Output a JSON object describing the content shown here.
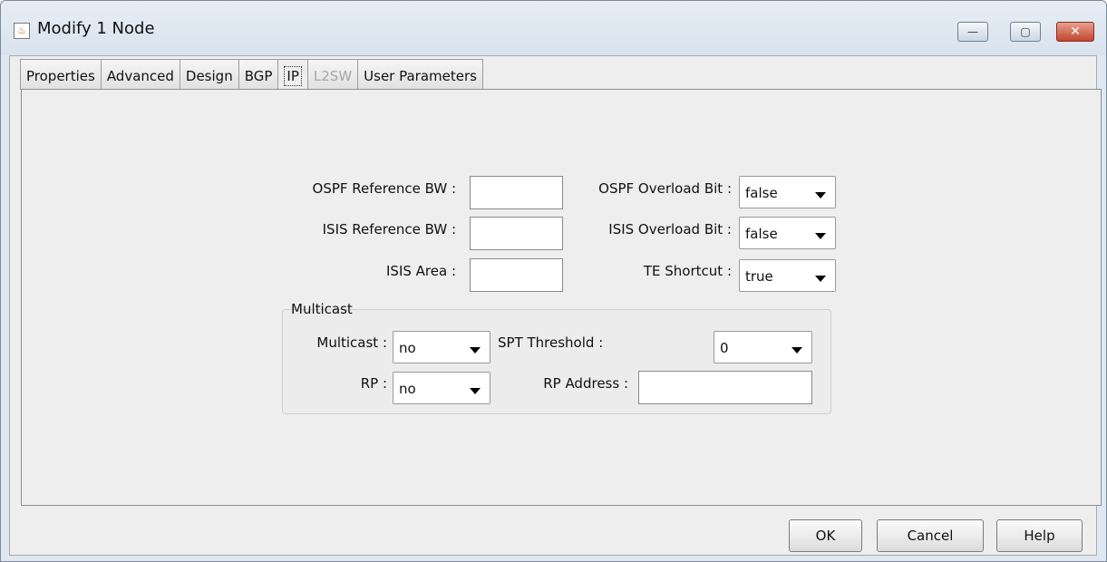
{
  "window": {
    "title": "Modify 1 Node",
    "controls": {
      "minimize": "—",
      "maximize": "▢",
      "close": "✕"
    }
  },
  "tabs": [
    {
      "label": "Properties",
      "state": "normal"
    },
    {
      "label": "Advanced",
      "state": "normal"
    },
    {
      "label": "Design",
      "state": "normal"
    },
    {
      "label": "BGP",
      "state": "normal"
    },
    {
      "label": "IP",
      "state": "active"
    },
    {
      "label": "L2SW",
      "state": "disabled"
    },
    {
      "label": "User Parameters",
      "state": "normal"
    }
  ],
  "ip": {
    "ospf_ref_bw_label": "OSPF Reference BW :",
    "ospf_ref_bw_value": "",
    "isis_ref_bw_label": "ISIS Reference BW :",
    "isis_ref_bw_value": "",
    "isis_area_label": "ISIS Area :",
    "isis_area_value": "",
    "ospf_overload_label": "OSPF Overload Bit :",
    "ospf_overload_value": "false",
    "isis_overload_label": "ISIS Overload Bit :",
    "isis_overload_value": "false",
    "te_shortcut_label": "TE Shortcut :",
    "te_shortcut_value": "true"
  },
  "multicast": {
    "group_title": "Multicast",
    "multicast_label": "Multicast :",
    "multicast_value": "no",
    "spt_label": "SPT Threshold :",
    "spt_value": "0",
    "rp_label": "RP :",
    "rp_value": "no",
    "rp_address_label": "RP Address :",
    "rp_address_value": ""
  },
  "buttons": {
    "ok": "OK",
    "cancel": "Cancel",
    "help": "Help"
  }
}
